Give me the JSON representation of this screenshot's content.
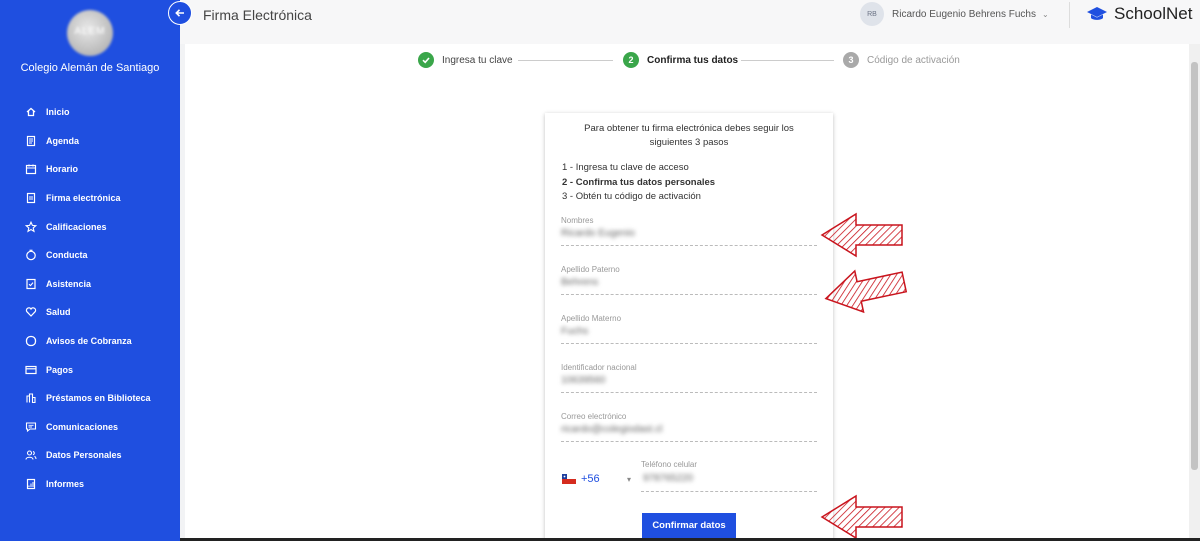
{
  "sidebar": {
    "avatar_text": "ALEM",
    "school_name": "Colegio Alemán de Santiago",
    "items": [
      {
        "label": "Inicio",
        "icon": "home-icon"
      },
      {
        "label": "Agenda",
        "icon": "agenda-icon"
      },
      {
        "label": "Horario",
        "icon": "calendar-icon"
      },
      {
        "label": "Firma electrónica",
        "icon": "signature-icon"
      },
      {
        "label": "Calificaciones",
        "icon": "star-icon"
      },
      {
        "label": "Conducta",
        "icon": "conduct-icon"
      },
      {
        "label": "Asistencia",
        "icon": "attendance-icon"
      },
      {
        "label": "Salud",
        "icon": "heart-icon"
      },
      {
        "label": "Avisos de Cobranza",
        "icon": "billing-icon"
      },
      {
        "label": "Pagos",
        "icon": "card-icon"
      },
      {
        "label": "Préstamos en Biblioteca",
        "icon": "library-icon"
      },
      {
        "label": "Comunicaciones",
        "icon": "message-icon"
      },
      {
        "label": "Datos Personales",
        "icon": "people-icon"
      },
      {
        "label": "Informes",
        "icon": "report-icon"
      }
    ]
  },
  "header": {
    "title": "Firma Electrónica",
    "user_initials": "RB",
    "user_name": "Ricardo Eugenio Behrens Fuchs",
    "brand": "SchoolNet"
  },
  "stepper": {
    "steps": [
      {
        "num": "✓",
        "label": "Ingresa tu clave",
        "state": "done"
      },
      {
        "num": "2",
        "label": "Confirma tus datos",
        "state": "active"
      },
      {
        "num": "3",
        "label": "Código de activación",
        "state": "pending"
      }
    ],
    "colors": {
      "done": "#3aa64a",
      "active": "#3aa64a",
      "pending": "#a9a9a9"
    }
  },
  "card": {
    "intro": "Para obtener tu firma electrónica debes seguir los siguientes 3 pasos",
    "step1": "1 - Ingresa tu clave de acceso",
    "step2": "2 - Confirma tus datos personales",
    "step3": "3 - Obtén tu código de activación",
    "fields": [
      {
        "label": "Nombres",
        "value": "Ricardo Eugenio"
      },
      {
        "label": "Apellido Paterno",
        "value": "Behrens"
      },
      {
        "label": "Apellido Materno",
        "value": "Fuchs"
      },
      {
        "label": "Identificador nacional",
        "value": "10639560"
      },
      {
        "label": "Correo electrónico",
        "value": "ricardo@colegiodast.cl"
      }
    ],
    "phone": {
      "country_code": "+56",
      "label": "Teléfono celular",
      "value": "978765220"
    },
    "confirm_label": "Confirmar datos"
  },
  "colors": {
    "sidebar": "#1f4fe0",
    "accent": "#1f4fe0",
    "step_done": "#3aa64a",
    "annotation_arrow": "#c9141d"
  }
}
